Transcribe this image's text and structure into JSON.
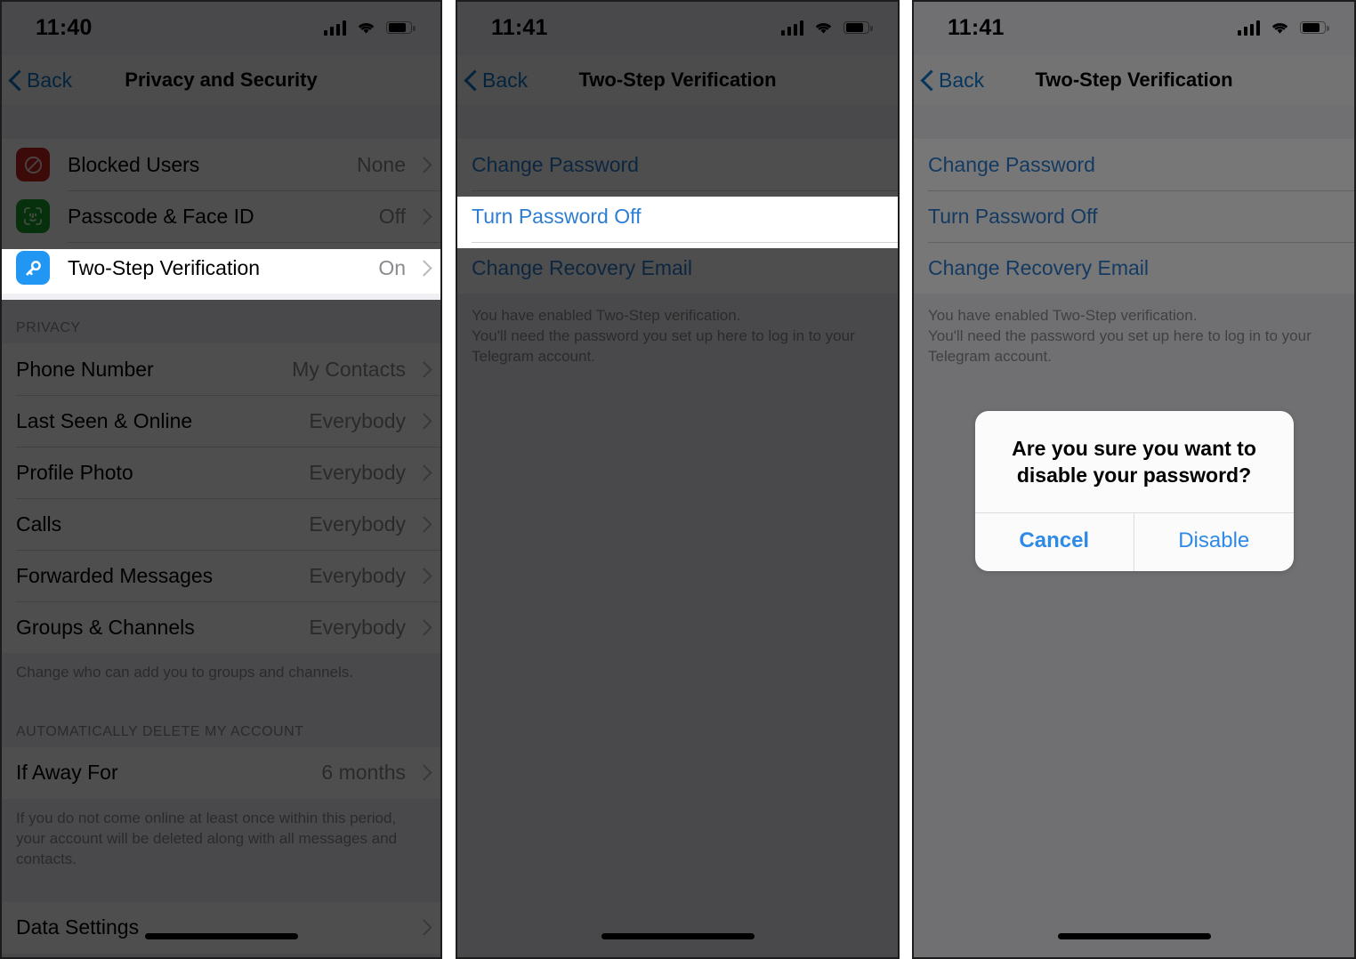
{
  "panels": [
    {
      "id": "privacy-security",
      "status": {
        "time": "11:40",
        "signal_icon": "signal-bars-icon",
        "wifi_icon": "wifi-icon",
        "battery_icon": "battery-icon"
      },
      "nav": {
        "back_label": "Back",
        "title": "Privacy and Security"
      },
      "security_rows": [
        {
          "icon": "blocked-users-icon",
          "label": "Blocked Users",
          "value": "None"
        },
        {
          "icon": "face-id-icon",
          "label": "Passcode & Face ID",
          "value": "Off"
        },
        {
          "icon": "two-step-key-icon",
          "label": "Two-Step Verification",
          "value": "On",
          "highlighted": true
        }
      ],
      "privacy_header": "PRIVACY",
      "privacy_rows": [
        {
          "label": "Phone Number",
          "value": "My Contacts"
        },
        {
          "label": "Last Seen & Online",
          "value": "Everybody"
        },
        {
          "label": "Profile Photo",
          "value": "Everybody"
        },
        {
          "label": "Calls",
          "value": "Everybody"
        },
        {
          "label": "Forwarded Messages",
          "value": "Everybody"
        },
        {
          "label": "Groups & Channels",
          "value": "Everybody"
        }
      ],
      "privacy_note": "Change who can add you to groups and channels.",
      "delete_header": "AUTOMATICALLY DELETE MY ACCOUNT",
      "delete_row": {
        "label": "If Away For",
        "value": "6 months"
      },
      "delete_note": "If you do not come online at least once within this period, your account will be deleted along with all messages and contacts.",
      "data_settings_row": {
        "label": "Data Settings",
        "value": ""
      }
    },
    {
      "id": "two-step-verification-highlight",
      "status": {
        "time": "11:41",
        "signal_icon": "signal-bars-icon",
        "wifi_icon": "wifi-icon",
        "battery_icon": "battery-icon"
      },
      "nav": {
        "back_label": "Back",
        "title": "Two-Step Verification"
      },
      "rows": [
        {
          "label": "Change Password"
        },
        {
          "label": "Turn Password Off",
          "highlighted": true
        },
        {
          "label": "Change Recovery Email"
        }
      ],
      "note": "You have enabled Two-Step verification.\nYou'll need the password you set up here to log in to your Telegram account."
    },
    {
      "id": "two-step-verification-alert",
      "status": {
        "time": "11:41",
        "signal_icon": "signal-bars-icon",
        "wifi_icon": "wifi-icon",
        "battery_icon": "battery-icon"
      },
      "nav": {
        "back_label": "Back",
        "title": "Two-Step Verification"
      },
      "rows": [
        {
          "label": "Change Password"
        },
        {
          "label": "Turn Password Off"
        },
        {
          "label": "Change Recovery Email"
        }
      ],
      "note": "You have enabled Two-Step verification.\nYou'll need the password you set up here to log in to your Telegram account.",
      "alert": {
        "title": "Are you sure you want to disable your password?",
        "cancel_label": "Cancel",
        "confirm_label": "Disable"
      }
    }
  ],
  "colors": {
    "link_blue": "#2d7dd2",
    "nav_blue": "#0f74c8",
    "alert_blue": "#2e8ae6",
    "icon_red": "#c1231f",
    "icon_green": "#17a22a",
    "icon_blue": "#2196f3"
  }
}
